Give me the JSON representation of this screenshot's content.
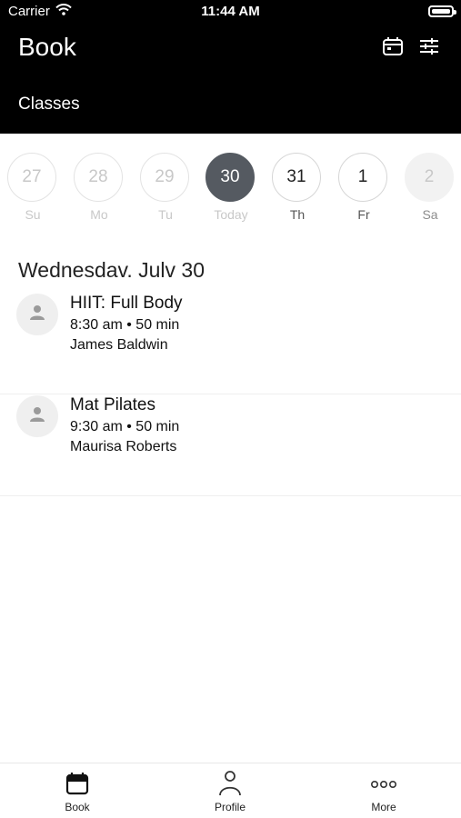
{
  "status_bar": {
    "carrier": "Carrier",
    "time": "11:44 AM"
  },
  "header": {
    "title": "Book",
    "section": "Classes"
  },
  "days": [
    {
      "number": "27",
      "label": "Su",
      "state": "past"
    },
    {
      "number": "28",
      "label": "Mo",
      "state": "past"
    },
    {
      "number": "29",
      "label": "Tu",
      "state": "past"
    },
    {
      "number": "30",
      "label": "Today",
      "state": "selected"
    },
    {
      "number": "31",
      "label": "Th",
      "state": "future"
    },
    {
      "number": "1",
      "label": "Fr",
      "state": "future"
    },
    {
      "number": "2",
      "label": "Sa",
      "state": "disabled"
    }
  ],
  "date_heading": "Wednesdav. Julv 30",
  "classes": [
    {
      "name": "HIIT: Full Body",
      "time": "8:30 am • 50 min",
      "teacher": "James Baldwin"
    },
    {
      "name": "Mat Pilates",
      "time": "9:30 am • 50 min",
      "teacher": "Maurisa Roberts"
    }
  ],
  "tabs": [
    {
      "label": "Book",
      "icon": "calendar-icon"
    },
    {
      "label": "Profile",
      "icon": "person-icon"
    },
    {
      "label": "More",
      "icon": "more-dots-icon"
    }
  ],
  "colors": {
    "header_bg": "#000000",
    "selected_day": "#555a61"
  }
}
